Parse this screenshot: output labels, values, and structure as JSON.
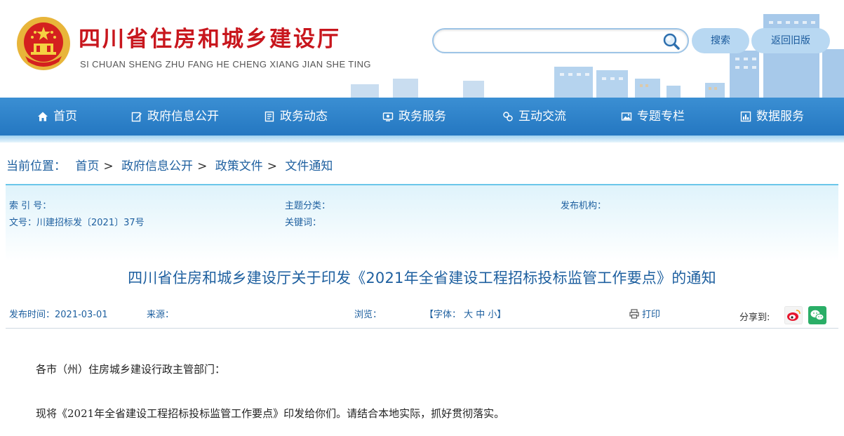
{
  "header": {
    "site_title": "四川省住房和城乡建设厅",
    "site_pinyin": "SI CHUAN SHENG ZHU FANG HE CHENG XIANG JIAN SHE TING",
    "search_placeholder": "",
    "search_button": "搜索",
    "old_version_button": "返回旧版"
  },
  "nav": {
    "items": [
      {
        "label": "首页",
        "icon": "home-icon"
      },
      {
        "label": "政府信息公开",
        "icon": "edit-icon"
      },
      {
        "label": "政务动态",
        "icon": "document-icon"
      },
      {
        "label": "政务服务",
        "icon": "service-icon"
      },
      {
        "label": "互动交流",
        "icon": "interaction-icon"
      },
      {
        "label": "专题专栏",
        "icon": "image-icon"
      },
      {
        "label": "数据服务",
        "icon": "chart-icon"
      }
    ]
  },
  "breadcrumb": {
    "prefix": "当前位置：",
    "items": [
      "首页",
      "政府信息公开",
      "政策文件",
      "文件通知"
    ],
    "separator": ">"
  },
  "meta": {
    "index_no": "索 引 号：",
    "topic": "主题分类：",
    "publisher": "发布机构：",
    "doc_no": "文号：川建招标发〔2021〕37号",
    "keywords": "关键词："
  },
  "article": {
    "title": "四川省住房和城乡建设厅关于印发《2021年全省建设工程招标投标监管工作要点》的通知",
    "publish_time": "发布时间：2021-03-01",
    "source": "来源：",
    "views": "浏览：",
    "font_size": "【字体： 大 中 小】",
    "print": "打印",
    "share": "分享到:",
    "paragraphs": [
      "各市（州）住房城乡建设行政主管部门：",
      "现将《2021年全省建设工程招标投标监管工作要点》印发给你们。请结合本地实际，抓好贯彻落实。"
    ]
  },
  "colors": {
    "title_red": "#c8161d",
    "nav_blue": "#2a7cc4",
    "link_blue": "#1d5f9f"
  }
}
